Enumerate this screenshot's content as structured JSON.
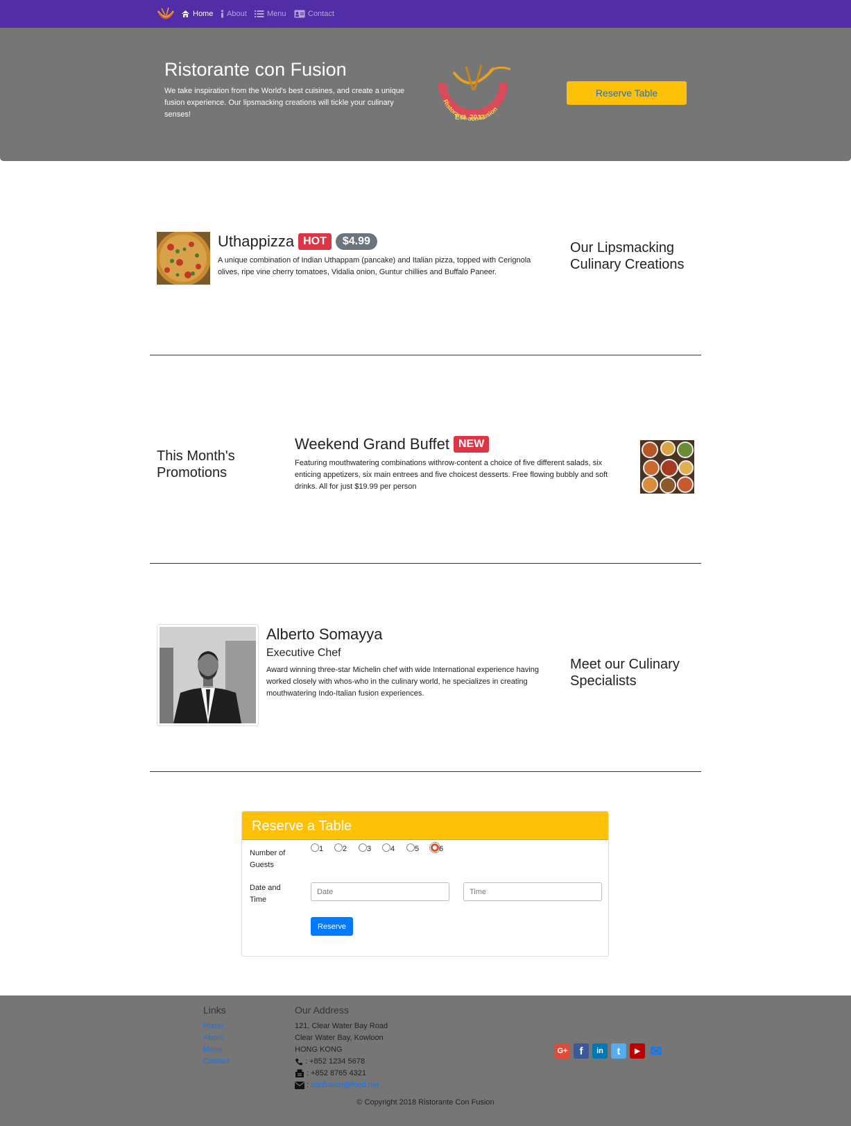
{
  "nav": {
    "items": [
      {
        "label": "Home",
        "icon": "home-icon"
      },
      {
        "label": "About",
        "icon": "info-icon"
      },
      {
        "label": "Menu",
        "icon": "list-icon"
      },
      {
        "label": "Contact",
        "icon": "address-card-icon"
      }
    ]
  },
  "jumbotron": {
    "title": "Ristorante con Fusion",
    "text": "We take inspiration from the World's best cuisines, and create a unique fusion experience. Our lipsmacking creations will tickle your culinary senses!",
    "logo_text": "Ristorante con Fusion",
    "logo_est": "Est. 2013",
    "reserve_label": "Reserve Table"
  },
  "dish": {
    "name": "Uthappizza",
    "badge": "HOT",
    "price": "$4.99",
    "description": "A unique combination of Indian Uthappam (pancake) and Italian pizza, topped with Cerignola olives, ripe vine cherry tomatoes, Vidalia onion, Guntur chillies and Buffalo Paneer.",
    "side_title": "Our Lipsmacking Culinary Creations"
  },
  "promotion": {
    "side_title": "This Month's Promotions",
    "name": "Weekend Grand Buffet",
    "badge": "NEW",
    "description": "Featuring mouthwatering combinations withrow-content a choice of five different salads, six enticing appetizers, six main entrees and five choicest desserts. Free flowing bubbly and soft drinks. All for just $19.99 per person"
  },
  "leader": {
    "name": "Alberto Somayya",
    "designation": "Executive Chef",
    "description": "Award winning three-star Michelin chef with wide International experience having worked closely with whos-who in the culinary world, he specializes in creating mouthwatering Indo-Italian fusion experiences.",
    "side_title": "Meet our Culinary Specialists"
  },
  "reserve": {
    "title": "Reserve a Table",
    "guests_label": "Number of Guests",
    "guest_options": [
      "1",
      "2",
      "3",
      "4",
      "5",
      "6"
    ],
    "selected_guests": "6",
    "datetime_label": "Date and Time",
    "date_placeholder": "Date",
    "time_placeholder": "Time",
    "submit_label": "Reserve"
  },
  "footer": {
    "links_heading": "Links",
    "links": [
      "Home",
      "About",
      "Menu",
      "Contact"
    ],
    "address_heading": "Our Address",
    "address_lines": [
      "121, Clear Water Bay Road",
      "Clear Water Bay, Kowloon",
      "HONG KONG"
    ],
    "phone": ": +852 1234 5678",
    "fax": ": +852 8765 4321",
    "email_prefix": ": ",
    "email": "confusion@food.net",
    "copyright": "© Copyright 2018 Ristorante Con Fusion",
    "social": [
      {
        "name": "google-plus-icon",
        "color": "#dd4b39",
        "glyph": "G+"
      },
      {
        "name": "facebook-icon",
        "color": "#3b5998",
        "glyph": "f"
      },
      {
        "name": "linkedin-icon",
        "color": "#0077b5",
        "glyph": "in"
      },
      {
        "name": "twitter-icon",
        "color": "#55acee",
        "glyph": "t"
      },
      {
        "name": "youtube-icon",
        "color": "#bb0000",
        "glyph": "▶"
      },
      {
        "name": "mail-icon",
        "color": "#007bff",
        "glyph": "✉"
      }
    ]
  }
}
